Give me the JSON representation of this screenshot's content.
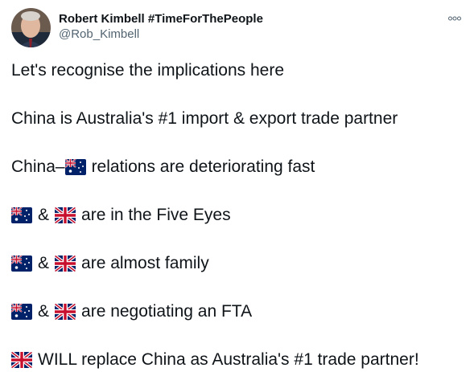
{
  "author": {
    "display_name": "Robert Kimbell #TimeForThePeople",
    "handle": "@Rob_Kimbell",
    "avatar_icon": "avatar-photo"
  },
  "more_icon": "more-options-icon",
  "tweet": {
    "line1": "Let's recognise the implications here",
    "line2": "China is Australia's #1 import & export trade partner",
    "line3_prefix": "China–",
    "line3_suffix": "relations are deteriorating fast",
    "amp": "&",
    "line4_suffix": "are in the Five Eyes",
    "line5_suffix": "are almost family",
    "line6_suffix": "are negotiating an FTA",
    "line7_suffix": "WILL replace China as Australia's #1 trade partner!"
  },
  "flags": {
    "australia": "flag-australia-icon",
    "uk": "flag-uk-icon"
  }
}
